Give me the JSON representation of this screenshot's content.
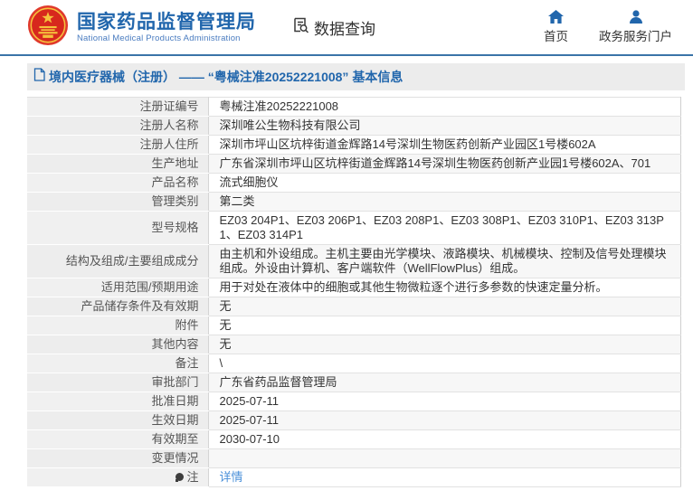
{
  "header": {
    "agency_cn": "国家药品监督管理局",
    "agency_en": "National Medical Products Administration",
    "nav_data_query": "数据查询",
    "nav_home": "首页",
    "nav_portal": "政务服务门户"
  },
  "page": {
    "title": "境内医疗器械（注册） —— “粤械注准20252221008” 基本信息"
  },
  "table": {
    "rows": [
      {
        "label": "注册证编号",
        "value": "粤械注准20252221008"
      },
      {
        "label": "注册人名称",
        "value": "深圳唯公生物科技有限公司"
      },
      {
        "label": "注册人住所",
        "value": "深圳市坪山区坑梓街道金辉路14号深圳生物医药创新产业园区1号楼602A"
      },
      {
        "label": "生产地址",
        "value": "广东省深圳市坪山区坑梓街道金辉路14号深圳生物医药创新产业园1号楼602A、701"
      },
      {
        "label": "产品名称",
        "value": "流式细胞仪"
      },
      {
        "label": "管理类别",
        "value": "第二类"
      },
      {
        "label": "型号规格",
        "value": "EZ03 204P1、EZ03 206P1、EZ03 208P1、EZ03 308P1、EZ03 310P1、EZ03 313P1、EZ03 314P1"
      },
      {
        "label": "结构及组成/主要组成成分",
        "value": "由主机和外设组成。主机主要由光学模块、液路模块、机械模块、控制及信号处理模块组成。外设由计算机、客户端软件（WellFlowPlus）组成。"
      },
      {
        "label": "适用范围/预期用途",
        "value": "用于对处在液体中的细胞或其他生物微粒逐个进行多参数的快速定量分析。"
      },
      {
        "label": "产品储存条件及有效期",
        "value": "无"
      },
      {
        "label": "附件",
        "value": "无"
      },
      {
        "label": "其他内容",
        "value": "无"
      },
      {
        "label": "备注",
        "value": "\\"
      },
      {
        "label": "审批部门",
        "value": "广东省药品监督管理局"
      },
      {
        "label": "批准日期",
        "value": "2025-07-11"
      },
      {
        "label": "生效日期",
        "value": "2025-07-11"
      },
      {
        "label": "有效期至",
        "value": "2030-07-10"
      },
      {
        "label": "变更情况",
        "value": ""
      },
      {
        "label": "注",
        "value": "详情",
        "value_type": "link",
        "label_icon": "note-icon"
      }
    ]
  },
  "colors": {
    "accent_blue": "#2166ac",
    "header_border_blue": "#3a74a8",
    "link_blue": "#4a90d9",
    "title_bar_bg": "#ececec",
    "label_cell_bg": "#f0f0f0",
    "stripe_bg": "#f7f7f7",
    "emblem_red": "#d7281d",
    "emblem_gold": "#f5c33c"
  }
}
